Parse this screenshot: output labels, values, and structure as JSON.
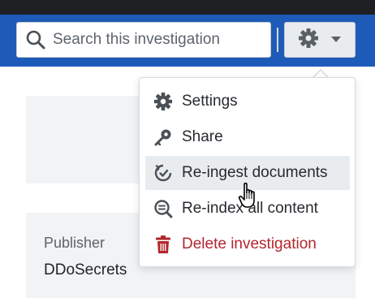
{
  "header": {
    "search_placeholder": "Search this investigation",
    "settings_menu_icon": "gear-icon",
    "caret_icon": "caret-down-icon"
  },
  "investigation": {
    "publisher_label": "Publisher",
    "publisher_value": "DDoSecrets"
  },
  "dropdown": {
    "items": [
      {
        "label": "Settings",
        "icon": "gear-icon",
        "state": "normal"
      },
      {
        "label": "Share",
        "icon": "key-icon",
        "state": "normal"
      },
      {
        "label": "Re-ingest documents",
        "icon": "reload-icon",
        "state": "hovered"
      },
      {
        "label": "Re-index all content",
        "icon": "search-list-icon",
        "state": "normal"
      },
      {
        "label": "Delete investigation",
        "icon": "trash-icon",
        "state": "danger"
      }
    ]
  },
  "colors": {
    "topbar": "#1e1f23",
    "navbar": "#1e5bb8",
    "panel": "#f1f3f5",
    "danger": "#b3262d",
    "hover": "#e9ecef"
  }
}
